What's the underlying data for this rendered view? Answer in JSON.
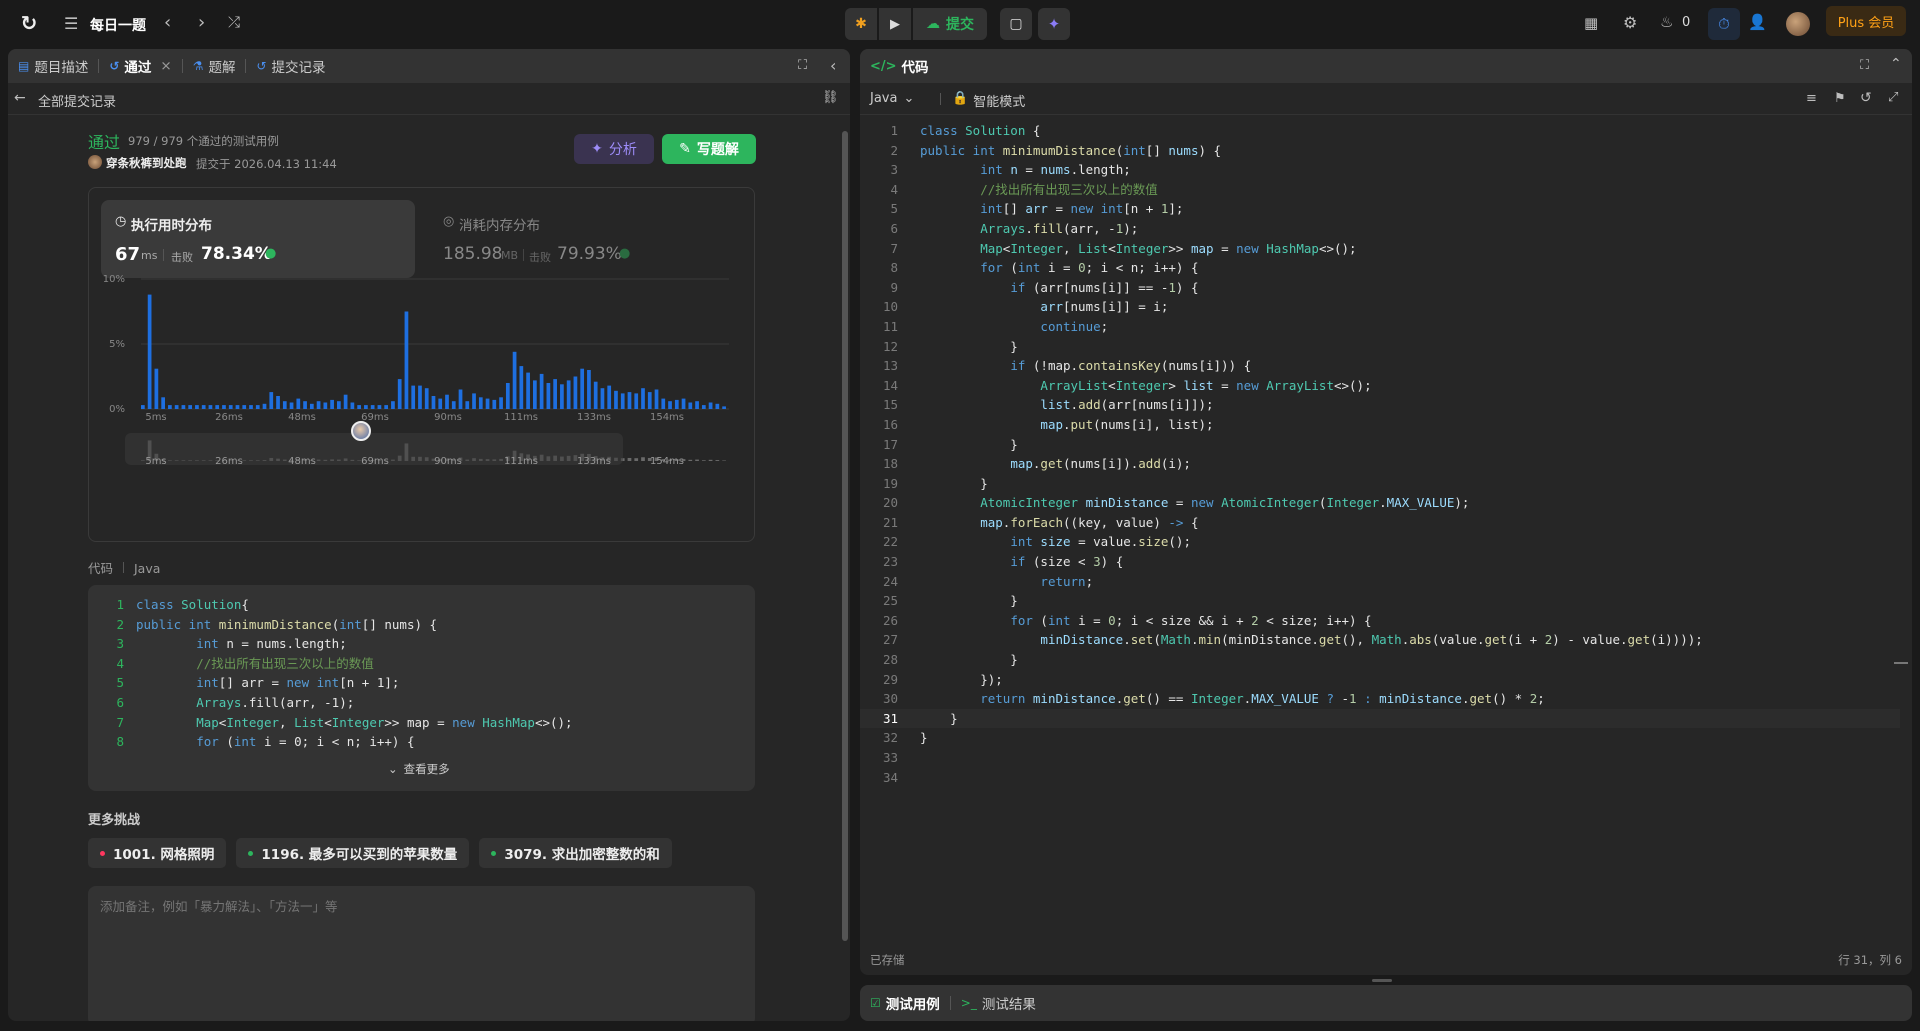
{
  "topbar": {
    "title": "每日一题",
    "submit": "提交",
    "flame_count": "0",
    "plus": "Plus 会员"
  },
  "left_panel": {
    "tabs": [
      {
        "label": "题目描述"
      },
      {
        "label": "通过"
      },
      {
        "label": "题解"
      },
      {
        "label": "提交记录"
      }
    ],
    "back_label": "全部提交记录",
    "result": {
      "status": "通过",
      "cases": "979 / 979 个通过的测试用例",
      "user": "穿条秋裤到处跑",
      "submitted": "提交于 2026.04.13 11:44"
    },
    "analyze_label": "分析",
    "write_solution_label": "写题解",
    "runtime": {
      "title": "执行用时分布",
      "value": "67",
      "unit": "ms",
      "beat_label": "击败",
      "beat": "78.34%"
    },
    "memory": {
      "title": "消耗内存分布",
      "value": "185.98",
      "unit": "MB",
      "beat_label": "击败",
      "beat": "79.93%"
    },
    "chart_data": {
      "type": "bar",
      "ylabels": [
        "10%",
        "5%",
        "0%"
      ],
      "xlabels": [
        "5ms",
        "26ms",
        "48ms",
        "69ms",
        "90ms",
        "111ms",
        "133ms",
        "154ms"
      ],
      "ylim": [
        0,
        10
      ],
      "values": [
        0.3,
        8.8,
        3.1,
        0.9,
        0.3,
        0.3,
        0.3,
        0.3,
        0.3,
        0.3,
        0.3,
        0.3,
        0.3,
        0.3,
        0.3,
        0.3,
        0.3,
        0.3,
        0.4,
        1.3,
        1.0,
        0.6,
        0.5,
        0.8,
        0.6,
        0.4,
        0.6,
        0.5,
        0.7,
        0.6,
        1.1,
        0.5,
        0.3,
        0.3,
        0.3,
        0.3,
        0.3,
        0.6,
        2.3,
        7.5,
        1.8,
        1.8,
        1.6,
        1.0,
        0.8,
        1.1,
        0.6,
        1.5,
        0.6,
        1.2,
        0.9,
        0.8,
        0.7,
        0.9,
        2.0,
        4.4,
        3.3,
        2.8,
        2.2,
        2.7,
        2.0,
        2.3,
        1.9,
        2.2,
        2.5,
        3.1,
        3.0,
        2.1,
        1.6,
        1.8,
        1.4,
        1.2,
        1.3,
        1.2,
        1.6,
        1.3,
        1.5,
        0.8,
        0.6,
        0.7,
        0.8,
        0.5,
        0.6,
        0.3,
        0.5,
        0.4,
        0.2
      ]
    },
    "code_section": {
      "title": "代码",
      "lang": "Java",
      "expand_label": "查看更多"
    },
    "preview_code": [
      [
        [
          "kw",
          "class "
        ],
        [
          "ty",
          "Solution"
        ],
        [
          "",
          "{"
        ]
      ],
      [
        [
          "kw",
          "public int "
        ],
        [
          "fn",
          "minimumDistance"
        ],
        [
          "",
          "("
        ],
        [
          "kw",
          "int"
        ],
        [
          "",
          "[] nums) {"
        ]
      ],
      [
        [
          "",
          "        "
        ],
        [
          "kw",
          "int "
        ],
        [
          "",
          "n = nums.length;"
        ]
      ],
      [
        [
          "",
          "        "
        ],
        [
          "cm",
          "//找出所有出现三次以上的数值"
        ]
      ],
      [
        [
          "",
          "        "
        ],
        [
          "kw",
          "int"
        ],
        [
          "",
          "[] arr = "
        ],
        [
          "kw",
          "new int"
        ],
        [
          "",
          "[n + 1];"
        ]
      ],
      [
        [
          "",
          "        "
        ],
        [
          "ty",
          "Arrays"
        ],
        [
          "",
          ".fill(arr, -1);"
        ]
      ],
      [
        [
          "",
          "        "
        ],
        [
          "ty",
          "Map"
        ],
        [
          "",
          "<"
        ],
        [
          "ty",
          "Integer"
        ],
        [
          "",
          ", "
        ],
        [
          "ty",
          "List"
        ],
        [
          "",
          "<"
        ],
        [
          "ty",
          "Integer"
        ],
        [
          "",
          ">> map = "
        ],
        [
          "kw",
          "new "
        ],
        [
          "ty",
          "HashMap"
        ],
        [
          "",
          "<>();"
        ]
      ],
      [
        [
          "",
          "        "
        ],
        [
          "kw",
          "for "
        ],
        [
          "",
          "("
        ],
        [
          "kw",
          "int "
        ],
        [
          "",
          "i = 0; i < n; i++) {"
        ]
      ]
    ],
    "more_challenges": {
      "title": "更多挑战",
      "items": [
        {
          "label": "1001. 网格照明",
          "color": "#ff375f"
        },
        {
          "label": "1196. 最多可以买到的苹果数量",
          "color": "#2db55d"
        },
        {
          "label": "3079. 求出加密整数的和",
          "color": "#2db55d"
        }
      ]
    },
    "note_placeholder": "添加备注，例如「暴力解法」、「方法一」等"
  },
  "code_panel": {
    "title": "代码",
    "lang": "Java",
    "mode": "智能模式",
    "saved": "已存储",
    "cursor": "行 31，列 6",
    "lines": [
      [
        [
          "kw",
          "class "
        ],
        [
          "ty",
          "Solution "
        ],
        [
          "",
          "{"
        ]
      ],
      [
        [
          "kw",
          "public int "
        ],
        [
          "fn",
          "minimumDistance"
        ],
        [
          "",
          "("
        ],
        [
          "kw",
          "int"
        ],
        [
          "",
          "[] "
        ],
        [
          "id",
          "nums"
        ],
        [
          "",
          ") {"
        ]
      ],
      [
        [
          "",
          "        "
        ],
        [
          "kw",
          "int "
        ],
        [
          "id",
          "n "
        ],
        [
          "",
          "= "
        ],
        [
          "id",
          "nums"
        ],
        [
          "",
          ".length;"
        ]
      ],
      [
        [
          "",
          "        "
        ],
        [
          "cm",
          "//找出所有出现三次以上的数值"
        ]
      ],
      [
        [
          "",
          "        "
        ],
        [
          "kw",
          "int"
        ],
        [
          "",
          "[] "
        ],
        [
          "id",
          "arr "
        ],
        [
          "",
          "= "
        ],
        [
          "kw",
          "new int"
        ],
        [
          "",
          "[n + "
        ],
        [
          "nm",
          "1"
        ],
        [
          "",
          "];"
        ]
      ],
      [
        [
          "",
          "        "
        ],
        [
          "ty",
          "Arrays"
        ],
        [
          "",
          "."
        ],
        [
          "fn",
          "fill"
        ],
        [
          "",
          "(arr, -"
        ],
        [
          "nm",
          "1"
        ],
        [
          "",
          ");"
        ]
      ],
      [
        [
          "",
          "        "
        ],
        [
          "ty",
          "Map"
        ],
        [
          "",
          "<"
        ],
        [
          "ty",
          "Integer"
        ],
        [
          "",
          ", "
        ],
        [
          "ty",
          "List"
        ],
        [
          "",
          "<"
        ],
        [
          "ty",
          "Integer"
        ],
        [
          "",
          ">> "
        ],
        [
          "id",
          "map "
        ],
        [
          "",
          "= "
        ],
        [
          "kw",
          "new "
        ],
        [
          "ty",
          "HashMap"
        ],
        [
          "",
          "<>();"
        ]
      ],
      [
        [
          "",
          "        "
        ],
        [
          "kw",
          "for "
        ],
        [
          "",
          "("
        ],
        [
          "kw",
          "int "
        ],
        [
          "",
          "i = "
        ],
        [
          "nm",
          "0"
        ],
        [
          "",
          "; i < n; i++) {"
        ]
      ],
      [
        [
          "",
          "            "
        ],
        [
          "kw",
          "if "
        ],
        [
          "",
          "(arr[nums[i]] == -"
        ],
        [
          "nm",
          "1"
        ],
        [
          "",
          ") {"
        ]
      ],
      [
        [
          "",
          "                "
        ],
        [
          "id",
          "arr"
        ],
        [
          "",
          "[nums[i]] = i;"
        ]
      ],
      [
        [
          "",
          "                "
        ],
        [
          "kw",
          "continue"
        ],
        [
          "",
          ";"
        ]
      ],
      [
        [
          "",
          "            }"
        ]
      ],
      [
        [
          "",
          "            "
        ],
        [
          "kw",
          "if "
        ],
        [
          "",
          "(!map."
        ],
        [
          "fn",
          "containsKey"
        ],
        [
          "",
          "(nums[i])) {"
        ]
      ],
      [
        [
          "",
          "                "
        ],
        [
          "ty",
          "ArrayList"
        ],
        [
          "",
          "<"
        ],
        [
          "ty",
          "Integer"
        ],
        [
          "",
          "> "
        ],
        [
          "id",
          "list "
        ],
        [
          "",
          "= "
        ],
        [
          "kw",
          "new "
        ],
        [
          "ty",
          "ArrayList"
        ],
        [
          "",
          "<>();"
        ]
      ],
      [
        [
          "",
          "                "
        ],
        [
          "id",
          "list"
        ],
        [
          "",
          "."
        ],
        [
          "fn",
          "add"
        ],
        [
          "",
          "(arr[nums[i]]);"
        ]
      ],
      [
        [
          "",
          "                "
        ],
        [
          "id",
          "map"
        ],
        [
          "",
          "."
        ],
        [
          "fn",
          "put"
        ],
        [
          "",
          "(nums[i], list);"
        ]
      ],
      [
        [
          "",
          "            }"
        ]
      ],
      [
        [
          "",
          "            "
        ],
        [
          "id",
          "map"
        ],
        [
          "",
          "."
        ],
        [
          "fn",
          "get"
        ],
        [
          "",
          "(nums[i])."
        ],
        [
          "fn",
          "add"
        ],
        [
          "",
          "(i);"
        ]
      ],
      [
        [
          "",
          "        }"
        ]
      ],
      [
        [
          "",
          "        "
        ],
        [
          "ty",
          "AtomicInteger "
        ],
        [
          "id",
          "minDistance "
        ],
        [
          "",
          "= "
        ],
        [
          "kw",
          "new "
        ],
        [
          "ty",
          "AtomicInteger"
        ],
        [
          "",
          "("
        ],
        [
          "ty",
          "Integer"
        ],
        [
          "",
          "."
        ],
        [
          "id",
          "MAX_VALUE"
        ],
        [
          "",
          ");"
        ]
      ],
      [
        [
          "",
          "        "
        ],
        [
          "id",
          "map"
        ],
        [
          "",
          "."
        ],
        [
          "fn",
          "forEach"
        ],
        [
          "",
          "((key, value) "
        ],
        [
          "kw",
          "-> "
        ],
        [
          "",
          "{"
        ]
      ],
      [
        [
          "",
          "            "
        ],
        [
          "kw",
          "int "
        ],
        [
          "id",
          "size "
        ],
        [
          "",
          "= value."
        ],
        [
          "fn",
          "size"
        ],
        [
          "",
          "();"
        ]
      ],
      [
        [
          "",
          "            "
        ],
        [
          "kw",
          "if "
        ],
        [
          "",
          "(size < "
        ],
        [
          "nm",
          "3"
        ],
        [
          "",
          ") {"
        ]
      ],
      [
        [
          "",
          "                "
        ],
        [
          "kw",
          "return"
        ],
        [
          "",
          ";"
        ]
      ],
      [
        [
          "",
          "            }"
        ]
      ],
      [
        [
          "",
          "            "
        ],
        [
          "kw",
          "for "
        ],
        [
          "",
          "("
        ],
        [
          "kw",
          "int "
        ],
        [
          "",
          "i = "
        ],
        [
          "nm",
          "0"
        ],
        [
          "",
          "; i < size && i + "
        ],
        [
          "nm",
          "2"
        ],
        [
          "",
          " < size; i++) {"
        ]
      ],
      [
        [
          "",
          "                "
        ],
        [
          "id",
          "minDistance"
        ],
        [
          "",
          "."
        ],
        [
          "fn",
          "set"
        ],
        [
          "",
          "("
        ],
        [
          "ty",
          "Math"
        ],
        [
          "",
          "."
        ],
        [
          "fn",
          "min"
        ],
        [
          "",
          "(minDistance."
        ],
        [
          "fn",
          "get"
        ],
        [
          "",
          "(), "
        ],
        [
          "ty",
          "Math"
        ],
        [
          "",
          "."
        ],
        [
          "fn",
          "abs"
        ],
        [
          "",
          "(value."
        ],
        [
          "fn",
          "get"
        ],
        [
          "",
          "(i + "
        ],
        [
          "nm",
          "2"
        ],
        [
          "",
          ") - value."
        ],
        [
          "fn",
          "get"
        ],
        [
          "",
          "(i))));"
        ]
      ],
      [
        [
          "",
          "            }"
        ]
      ],
      [
        [
          "",
          "        });"
        ]
      ],
      [
        [
          "",
          "        "
        ],
        [
          "kw",
          "return "
        ],
        [
          "id",
          "minDistance"
        ],
        [
          "",
          "."
        ],
        [
          "fn",
          "get"
        ],
        [
          "",
          "() == "
        ],
        [
          "ty",
          "Integer"
        ],
        [
          "",
          "."
        ],
        [
          "id",
          "MAX_VALUE "
        ],
        [
          "kw",
          "? "
        ],
        [
          "",
          "-"
        ],
        [
          "nm",
          "1 "
        ],
        [
          "kw",
          ": "
        ],
        [
          "id",
          "minDistance"
        ],
        [
          "",
          "."
        ],
        [
          "fn",
          "get"
        ],
        [
          "",
          "() * "
        ],
        [
          "nm",
          "2"
        ],
        [
          "",
          ";"
        ]
      ],
      [
        [
          "",
          "    }"
        ]
      ],
      [
        [
          "",
          "}"
        ]
      ],
      [
        [
          "",
          ""
        ]
      ],
      [
        [
          "",
          ""
        ]
      ]
    ]
  },
  "bottom_panel": {
    "tab1": "测试用例",
    "tab2": "测试结果"
  }
}
